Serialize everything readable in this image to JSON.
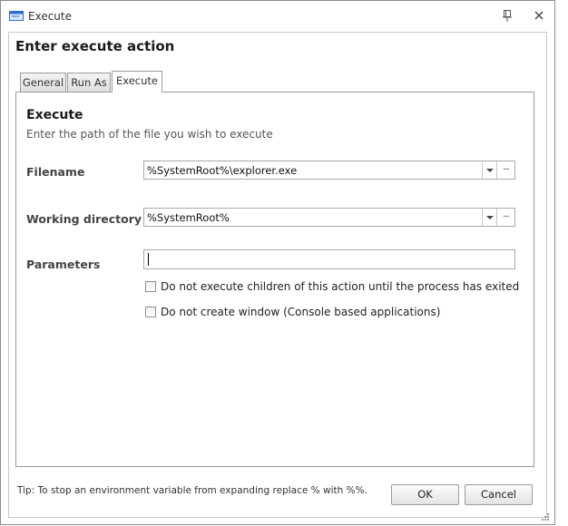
{
  "window": {
    "title": "Execute",
    "heading": "Enter execute action"
  },
  "tabs": [
    {
      "label": "General",
      "active": false
    },
    {
      "label": "Run As",
      "active": false
    },
    {
      "label": "Execute",
      "active": true
    }
  ],
  "section": {
    "title": "Execute",
    "description": "Enter the path of the file you wish to execute"
  },
  "fields": {
    "filename": {
      "label": "Filename",
      "value": "%SystemRoot%\\explorer.exe",
      "browse_label": "..."
    },
    "working_directory": {
      "label": "Working directory",
      "value": "%SystemRoot%",
      "browse_label": "..."
    },
    "parameters": {
      "label": "Parameters",
      "value": ""
    }
  },
  "options": [
    {
      "label": "Do not execute children of this action until the process has exited",
      "checked": false
    },
    {
      "label": "Do not create window (Console based applications)",
      "checked": false
    }
  ],
  "tip": "Tip: To stop an environment variable from expanding replace % with %%.",
  "buttons": {
    "ok": "OK",
    "cancel": "Cancel"
  },
  "icons": {
    "title": "execute-icon",
    "pin": "pin-icon",
    "close": "close-icon",
    "dropdown": "chevron-down-icon"
  },
  "colors": {
    "border": "#9a9a9a",
    "title_icon": "#2a6fd6"
  }
}
